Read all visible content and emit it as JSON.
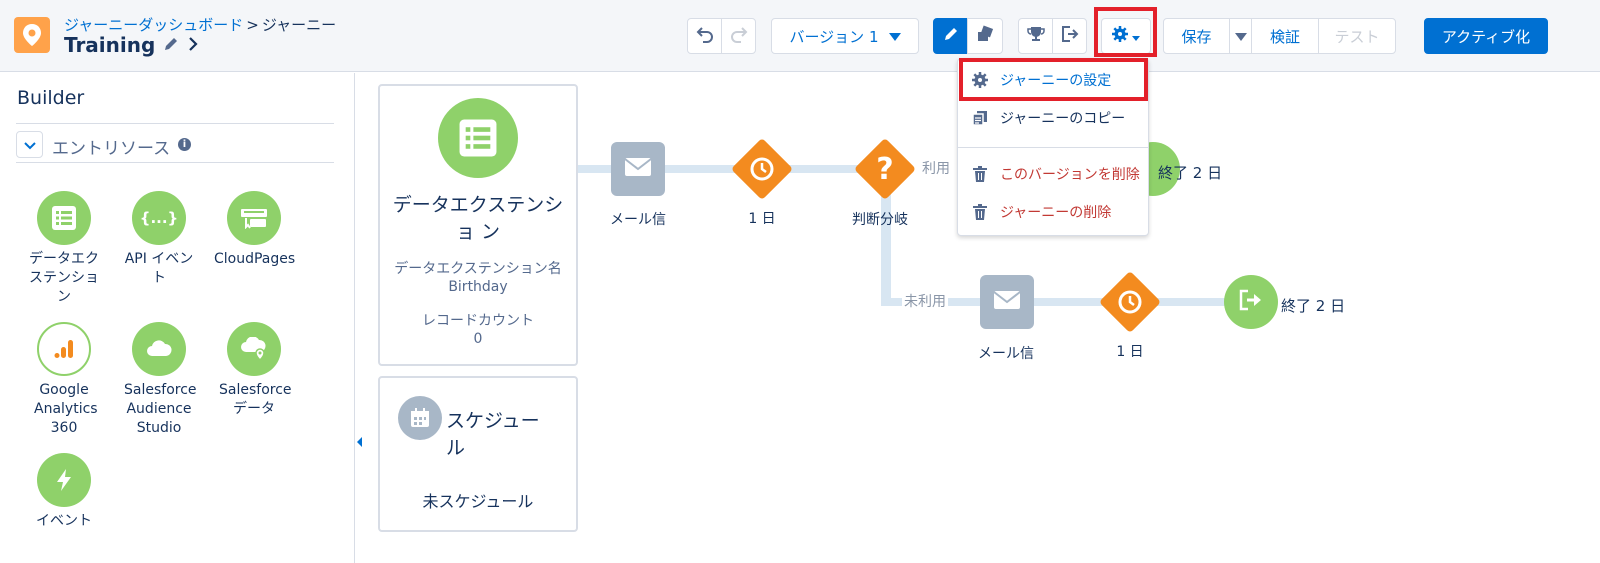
{
  "header": {
    "breadcrumb_link": "ジャーニーダッシュボード",
    "breadcrumb_sep": ">",
    "breadcrumb_current": "ジャーニー",
    "journey_name": "Training",
    "version_label": "バージョン 1",
    "save_label": "保存",
    "validate_label": "検証",
    "test_label": "テスト",
    "activate_label": "アクティブ化"
  },
  "sidebar": {
    "title": "Builder",
    "section_label": "エントリソース",
    "sources": [
      {
        "label": "データエク ステンショ ン",
        "icon": "data-extension-icon"
      },
      {
        "label": "API イベン ト",
        "icon": "api-event-icon"
      },
      {
        "label": "CloudPages",
        "icon": "cloudpages-icon"
      },
      {
        "label": "Google Analytics 360",
        "icon": "google-analytics-icon"
      },
      {
        "label": "Salesforce Audience Studio",
        "icon": "audience-studio-icon"
      },
      {
        "label": "Salesforce データ",
        "icon": "salesforce-data-icon"
      },
      {
        "label": "イベント",
        "icon": "event-icon"
      }
    ]
  },
  "canvas": {
    "entry_card": {
      "title": "データエクステンショ ン",
      "name_label": "データエクステンション名",
      "name_value": "Birthday",
      "count_label": "レコードカウント",
      "count_value": "0"
    },
    "schedule_card": {
      "title": "スケジュー ル",
      "status": "未スケジュール"
    },
    "nodes": {
      "email1_label": "メール信",
      "wait1_label": "1 日",
      "decision_label": "判断分岐",
      "path_yes_label": "利用",
      "end1_label": "終了 2 日",
      "path_no_label": "未利用",
      "email2_label": "メール信",
      "wait2_label": "1 日",
      "end2_label": "終了 2 日"
    }
  },
  "settings_menu": {
    "items": [
      {
        "label": "ジャーニーの設定",
        "icon": "gear-icon",
        "style": "highlighted"
      },
      {
        "label": "ジャーニーのコピー",
        "icon": "copy-icon",
        "style": "normal"
      },
      {
        "label": "このバージョンを削除",
        "icon": "trash-icon",
        "style": "danger"
      },
      {
        "label": "ジャーニーの削除",
        "icon": "trash-icon",
        "style": "danger"
      }
    ]
  },
  "colors": {
    "brand_blue": "#0070d2",
    "highlight_red": "#e3202a",
    "activity_green": "#8fd16a",
    "wait_orange": "#f38b1f",
    "email_gray": "#a8b7c7"
  }
}
